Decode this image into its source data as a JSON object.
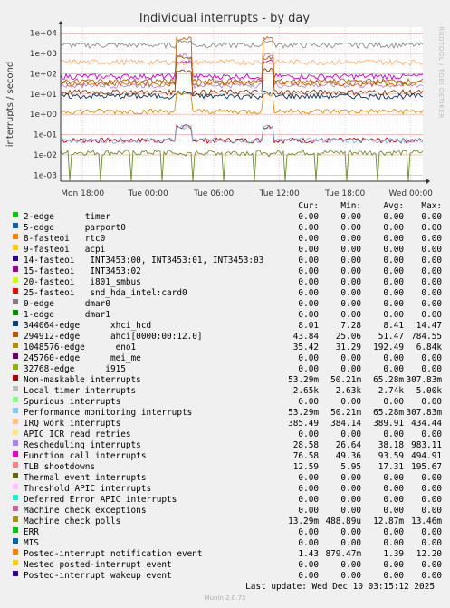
{
  "chart_data": {
    "type": "line",
    "title": "Individual interrupts - by day",
    "ylabel": "interrupts / second",
    "yscale": "log",
    "ylim": [
      0.0005,
      20000
    ],
    "yticks": [
      "1e-03",
      "1e-02",
      "1e-01",
      "1e+00",
      "1e+01",
      "1e+02",
      "1e+03",
      "1e+04"
    ],
    "xticks": [
      "Mon 18:00",
      "Tue 00:00",
      "Tue 06:00",
      "Tue 12:00",
      "Tue 18:00",
      "Wed 00:00"
    ],
    "grid": true,
    "series": [
      {
        "name": "Non-maskable interrupts",
        "color": "#CC0000",
        "base": 0.0533,
        "spike": 0.31
      },
      {
        "name": "Machine check polls",
        "color": "#6B8E23",
        "base": 0.0133,
        "spike": 0.0135
      },
      {
        "name": "Performance monitoring interrupts",
        "color": "#7EB6E8",
        "base": 0.0533,
        "spike": 0.31
      },
      {
        "name": "Local timer interrupts",
        "color": "#8C8C8C",
        "base": 2650,
        "spike": 5000
      },
      {
        "name": "Function call interrupts",
        "color": "#CC00CC",
        "base": 76,
        "spike": 494
      },
      {
        "name": "Rescheduling interrupts",
        "color": "#B088E8",
        "base": 28,
        "spike": 983
      },
      {
        "name": "TLB shootdowns",
        "color": "#993300",
        "base": 12.6,
        "spike": 195
      },
      {
        "name": "IRQ work interrupts",
        "color": "#FFB070",
        "base": 385,
        "spike": 434
      },
      {
        "name": "1048576-edge eno1",
        "color": "#CC6600",
        "base": 35,
        "spike": 6840
      },
      {
        "name": "294912-edge ahci[0000:00:12.0]",
        "color": "#AA6600",
        "base": 44,
        "spike": 785
      },
      {
        "name": "344064-edge xhci_hcd",
        "color": "#003366",
        "base": 8,
        "spike": 14.5
      },
      {
        "name": "Posted-interrupt notification event",
        "color": "#E68A00",
        "base": 1.43,
        "spike": 12.2
      }
    ]
  },
  "side_text": "RRDTOOL / TOBI OETIKER",
  "legend": {
    "headers": {
      "cur": "Cur:",
      "min": "Min:",
      "avg": "Avg:",
      "max": "Max:"
    },
    "rows": [
      {
        "label": "2-edge      timer",
        "color": "#00CC00",
        "cur": "0.00",
        "min": "0.00",
        "avg": "0.00",
        "max": "0.00"
      },
      {
        "label": "5-edge      parport0",
        "color": "#0066B3",
        "cur": "0.00",
        "min": "0.00",
        "avg": "0.00",
        "max": "0.00"
      },
      {
        "label": "8-fasteoi   rtc0",
        "color": "#FF8000",
        "cur": "0.00",
        "min": "0.00",
        "avg": "0.00",
        "max": "0.00"
      },
      {
        "label": "9-fasteoi   acpi",
        "color": "#FFCC00",
        "cur": "0.00",
        "min": "0.00",
        "avg": "0.00",
        "max": "0.00"
      },
      {
        "label": "14-fasteoi   INT3453:00, INT3453:01, INT3453:03",
        "color": "#330099",
        "cur": "0.00",
        "min": "0.00",
        "avg": "0.00",
        "max": "0.00"
      },
      {
        "label": "15-fasteoi   INT3453:02",
        "color": "#990099",
        "cur": "0.00",
        "min": "0.00",
        "avg": "0.00",
        "max": "0.00"
      },
      {
        "label": "20-fasteoi   i801_smbus",
        "color": "#CCFF00",
        "cur": "0.00",
        "min": "0.00",
        "avg": "0.00",
        "max": "0.00"
      },
      {
        "label": "25-fasteoi   snd_hda_intel:card0",
        "color": "#FF0000",
        "cur": "0.00",
        "min": "0.00",
        "avg": "0.00",
        "max": "0.00"
      },
      {
        "label": "0-edge      dmar0",
        "color": "#808080",
        "cur": "0.00",
        "min": "0.00",
        "avg": "0.00",
        "max": "0.00"
      },
      {
        "label": "1-edge      dmar1",
        "color": "#008F00",
        "cur": "0.00",
        "min": "0.00",
        "avg": "0.00",
        "max": "0.00"
      },
      {
        "label": "344064-edge      xhci_hcd",
        "color": "#00487D",
        "cur": "8.01",
        "min": "7.28",
        "avg": "8.41",
        "max": "14.47"
      },
      {
        "label": "294912-edge      ahci[0000:00:12.0]",
        "color": "#B35A00",
        "cur": "43.84",
        "min": "25.06",
        "avg": "51.47",
        "max": "784.55"
      },
      {
        "label": "1048576-edge      eno1",
        "color": "#B38F00",
        "cur": "35.42",
        "min": "31.29",
        "avg": "192.49",
        "max": "6.84k"
      },
      {
        "label": "245760-edge      mei_me",
        "color": "#6B006B",
        "cur": "0.00",
        "min": "0.00",
        "avg": "0.00",
        "max": "0.00"
      },
      {
        "label": "32768-edge      i915",
        "color": "#8FB300",
        "cur": "0.00",
        "min": "0.00",
        "avg": "0.00",
        "max": "0.00"
      },
      {
        "label": "Non-maskable interrupts",
        "color": "#B30000",
        "cur": "53.29m",
        "min": "50.21m",
        "avg": "65.28m",
        "max": "307.83m"
      },
      {
        "label": "Local timer interrupts",
        "color": "#BEBEBE",
        "cur": "2.65k",
        "min": "2.63k",
        "avg": "2.74k",
        "max": "5.00k"
      },
      {
        "label": "Spurious interrupts",
        "color": "#80FF80",
        "cur": "0.00",
        "min": "0.00",
        "avg": "0.00",
        "max": "0.00"
      },
      {
        "label": "Performance monitoring interrupts",
        "color": "#80C9FF",
        "cur": "53.29m",
        "min": "50.21m",
        "avg": "65.28m",
        "max": "307.83m"
      },
      {
        "label": "IRQ work interrupts",
        "color": "#FFC080",
        "cur": "385.49",
        "min": "384.14",
        "avg": "389.91",
        "max": "434.44"
      },
      {
        "label": "APIC ICR read retries",
        "color": "#FFE680",
        "cur": "0.00",
        "min": "0.00",
        "avg": "0.00",
        "max": "0.00"
      },
      {
        "label": "Rescheduling interrupts",
        "color": "#AA80FF",
        "cur": "28.58",
        "min": "26.64",
        "avg": "38.18",
        "max": "983.11"
      },
      {
        "label": "Function call interrupts",
        "color": "#EE00CC",
        "cur": "76.58",
        "min": "49.36",
        "avg": "93.59",
        "max": "494.91"
      },
      {
        "label": "TLB shootdowns",
        "color": "#FF8080",
        "cur": "12.59",
        "min": "5.95",
        "avg": "17.31",
        "max": "195.67"
      },
      {
        "label": "Thermal event interrupts",
        "color": "#666600",
        "cur": "0.00",
        "min": "0.00",
        "avg": "0.00",
        "max": "0.00"
      },
      {
        "label": "Threshold APIC interrupts",
        "color": "#FFBFFF",
        "cur": "0.00",
        "min": "0.00",
        "avg": "0.00",
        "max": "0.00"
      },
      {
        "label": "Deferred Error APIC interrupts",
        "color": "#00FFCC",
        "cur": "0.00",
        "min": "0.00",
        "avg": "0.00",
        "max": "0.00"
      },
      {
        "label": "Machine check exceptions",
        "color": "#CC6699",
        "cur": "0.00",
        "min": "0.00",
        "avg": "0.00",
        "max": "0.00"
      },
      {
        "label": "Machine check polls",
        "color": "#999900",
        "cur": "13.29m",
        "min": "488.89u",
        "avg": "12.87m",
        "max": "13.46m"
      },
      {
        "label": "ERR",
        "color": "#00CC00",
        "cur": "0.00",
        "min": "0.00",
        "avg": "0.00",
        "max": "0.00"
      },
      {
        "label": "MIS",
        "color": "#0066B3",
        "cur": "0.00",
        "min": "0.00",
        "avg": "0.00",
        "max": "0.00"
      },
      {
        "label": "Posted-interrupt notification event",
        "color": "#FF8000",
        "cur": "1.43",
        "min": "879.47m",
        "avg": "1.39",
        "max": "12.20"
      },
      {
        "label": "Nested posted-interrupt event",
        "color": "#FFCC00",
        "cur": "0.00",
        "min": "0.00",
        "avg": "0.00",
        "max": "0.00"
      },
      {
        "label": "Posted-interrupt wakeup event",
        "color": "#330099",
        "cur": "0.00",
        "min": "0.00",
        "avg": "0.00",
        "max": "0.00"
      }
    ],
    "last_update": "Last update: Wed Dec 10 03:15:12 2025"
  },
  "footer": "Munin 2.0.73"
}
